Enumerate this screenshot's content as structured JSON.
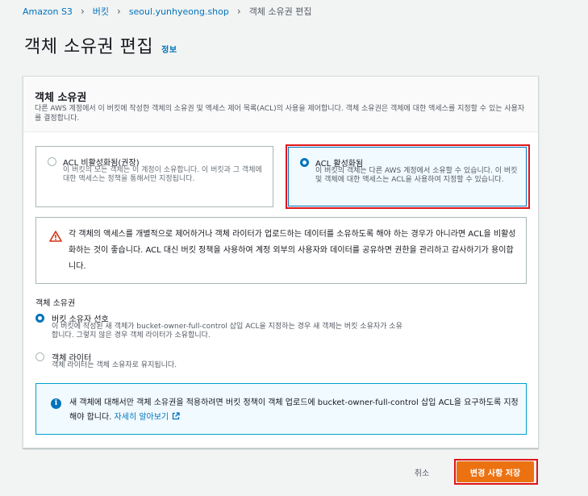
{
  "breadcrumb": {
    "items": [
      "Amazon S3",
      "버킷",
      "seoul.yunhyeong.shop"
    ],
    "current": "객체 소유권 편집"
  },
  "page": {
    "title": "객체 소유권 편집",
    "info_link": "정보"
  },
  "panel": {
    "title": "객체 소유권",
    "description": "다른 AWS 계정에서 이 버킷에 작성한 객체의 소유권 및 액세스 제어 목록(ACL)의 사용을 제어합니다. 객체 소유권은 객체에 대한 액세스를 지정할 수 있는 사용자를 결정합니다.",
    "acl_options": [
      {
        "title": "ACL 비활성화됨(권장)",
        "description": "이 버킷의 모든 객체는 이 계정이 소유합니다. 이 버킷과 그 객체에 대한 액세스는 정책을 통해서만 지정됩니다.",
        "selected": false
      },
      {
        "title": "ACL 활성화됨",
        "description": "이 버킷의 객체는 다른 AWS 계정에서 소유할 수 있습니다. 이 버킷 및 객체에 대한 액세스는 ACL을 사용하여 지정할 수 있습니다.",
        "selected": true
      }
    ],
    "warning": "각 객체의 액세스를 개별적으로 제어하거나 객체 라이터가 업로드하는 데이터를 소유하도록 해야 하는 경우가 아니라면 ACL을 비활성화하는 것이 좋습니다. ACL 대신 버킷 정책을 사용하여 계정 외부의 사용자와 데이터를 공유하면 권한을 관리하고 감사하기가 용이합니다.",
    "ownership_label": "객체 소유권",
    "ownership_options": [
      {
        "title": "버킷 소유자 선호",
        "description": "이 버킷에 작성된 새 객체가 bucket-owner-full-control 삽입 ACL을 지정하는 경우 새 객체는 버킷 소유자가 소유합니다. 그렇지 않은 경우 객체 라이터가 소유합니다.",
        "selected": true
      },
      {
        "title": "객체 라이터",
        "description": "객체 라이터는 객체 소유자로 유지됩니다.",
        "selected": false
      }
    ],
    "info": {
      "text": "새 객체에 대해서만 객체 소유권을 적용하려면 버킷 정책이 객체 업로드에 bucket-owner-full-control 삽입 ACL을 요구하도록 지정해야 합니다.",
      "link": "자세히 알아보기"
    }
  },
  "footer": {
    "cancel_label": "취소",
    "save_label": "변경 사항 저장"
  },
  "colors": {
    "accent": "#0073bb",
    "primary_button": "#ec7211",
    "highlight": "#e0141a",
    "warning_icon": "#d13212"
  }
}
